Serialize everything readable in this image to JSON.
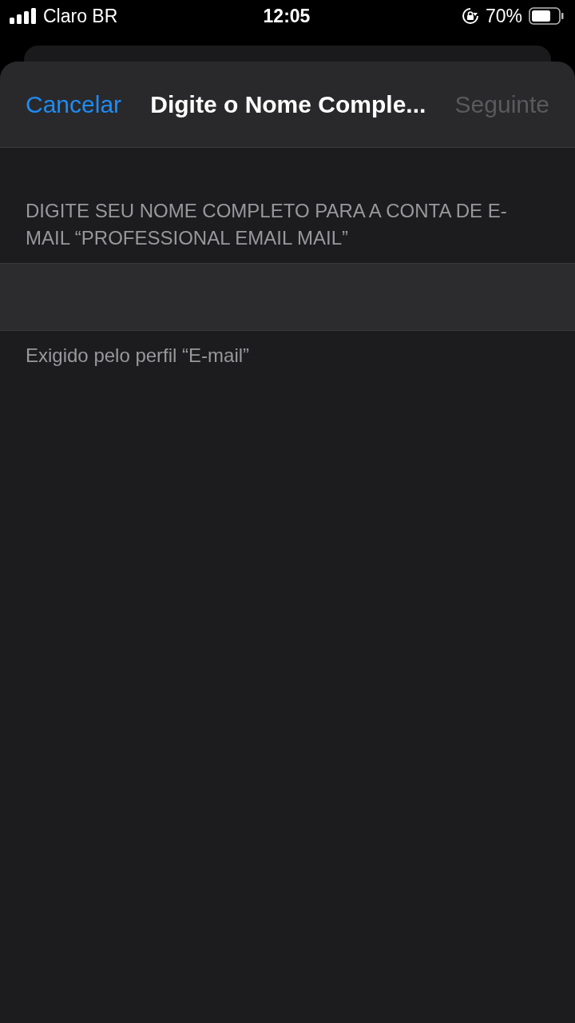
{
  "status_bar": {
    "carrier": "Claro BR",
    "time": "12:05",
    "battery": "70%"
  },
  "nav_bar": {
    "cancel": "Cancelar",
    "title": "Digite o Nome Comple...",
    "next": {
      "label": "Seguinte",
      "disabled": true
    }
  },
  "section": {
    "header": "DIGITE SEU NOME COMPLETO PARA A CONTA DE E-MAIL “PROFESSIONAL EMAIL MAIL”",
    "footer": "Exigido pelo perfil “E-mail”"
  }
}
